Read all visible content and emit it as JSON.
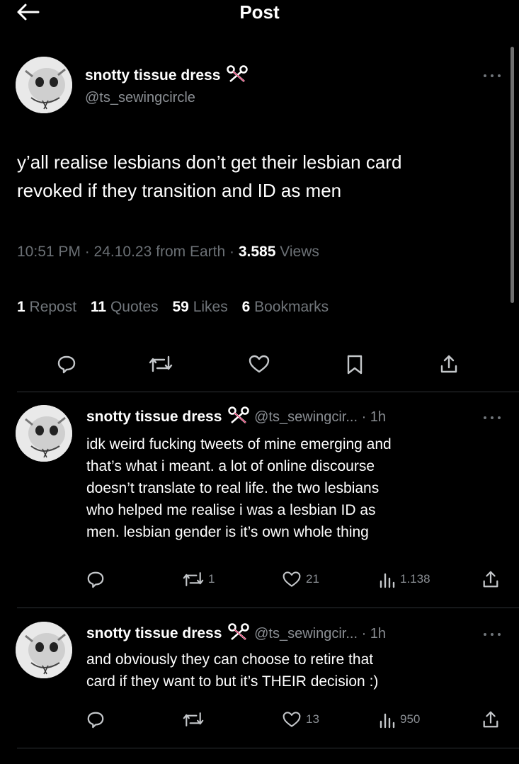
{
  "header": {
    "title": "Post"
  },
  "post": {
    "author_name": "snotty tissue dress",
    "author_handle": "@ts_sewingcircle",
    "text_line1": "y’all realise lesbians don’t get their lesbian card",
    "text_line2": "revoked if they transition and ID as men",
    "time": "10:51 PM · 24.10.23 from Earth · ",
    "views_count": "3.585",
    "views_label": " Views",
    "stats": {
      "reposts_count": "1",
      "reposts_label": " Repost",
      "quotes_count": "11",
      "quotes_label": " Quotes",
      "likes_count": "59",
      "likes_label": " Likes",
      "bookmarks_count": "6",
      "bookmarks_label": " Bookmarks"
    },
    "actions": [
      "reply-icon",
      "repost-icon",
      "like-icon",
      "bookmark-icon",
      "share-icon"
    ]
  },
  "replies": [
    {
      "author_name": "snotty tissue dress",
      "author_handle": "@ts_sewingcir...",
      "time": " · 1h",
      "lines": [
        "idk weird fucking tweets of mine emerging and",
        "that’s what i meant. a lot of online discourse",
        "doesn’t translate to real life. the two lesbians",
        "who helped me realise i was a lesbian ID as",
        "men. lesbian gender is it’s own whole thing"
      ],
      "reposts": "1",
      "likes": "21",
      "views": "1.138"
    },
    {
      "author_name": "snotty tissue dress",
      "author_handle": "@ts_sewingcir...",
      "time": " · 1h",
      "lines": [
        "and obviously they can choose to retire that",
        "card if they want to but it’s THEIR decision :)"
      ],
      "reposts": "",
      "likes": "13",
      "views": "950"
    }
  ],
  "colors": {
    "background": "#000000",
    "text": "#ffffff",
    "secondary": "#71767b",
    "divider": "#2f3336"
  }
}
